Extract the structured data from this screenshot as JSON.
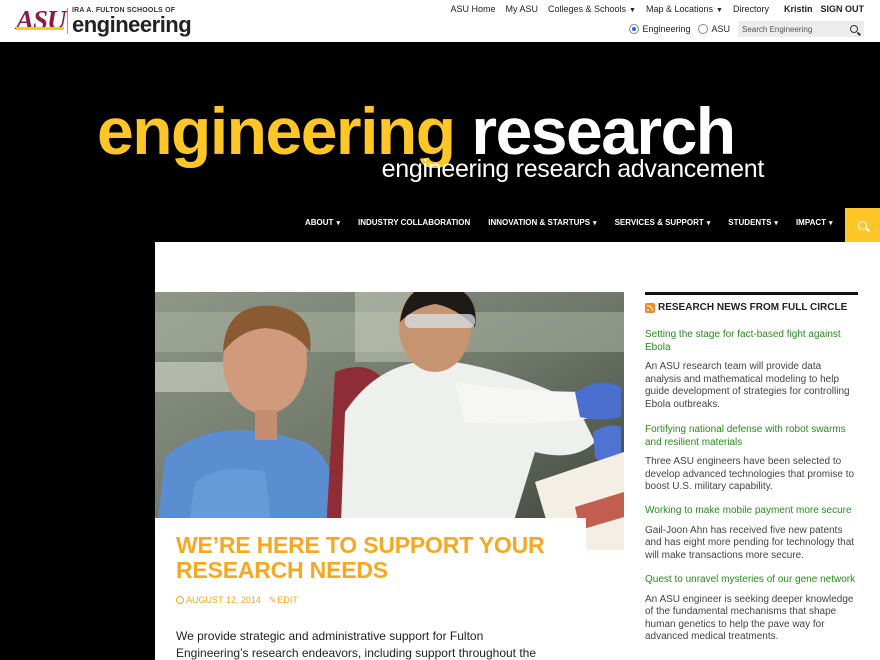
{
  "logo": {
    "mark": "ASU",
    "sub": "IRA A. FULTON SCHOOLS OF",
    "main": "engineering"
  },
  "utility_nav": {
    "items": [
      {
        "label": "ASU Home",
        "has_caret": false
      },
      {
        "label": "My ASU",
        "has_caret": false
      },
      {
        "label": "Colleges & Schools",
        "has_caret": true
      },
      {
        "label": "Map & Locations",
        "has_caret": true
      },
      {
        "label": "Directory",
        "has_caret": false
      }
    ],
    "user": "Kristin",
    "signout": "SIGN OUT"
  },
  "search": {
    "radio_engineering": "Engineering",
    "radio_asu": "ASU",
    "selected": "Engineering",
    "placeholder": "Search Engineering"
  },
  "hero": {
    "title_gold": "engineering",
    "title_white": "research",
    "subtitle": "engineering research advancement"
  },
  "main_nav": {
    "items": [
      {
        "label": "ABOUT",
        "caret": "▾"
      },
      {
        "label": "INDUSTRY COLLABORATION",
        "caret": ""
      },
      {
        "label": "INNOVATION & STARTUPS",
        "caret": "▾"
      },
      {
        "label": "SERVICES & SUPPORT",
        "caret": "▾"
      },
      {
        "label": "STUDENTS",
        "caret": "▾"
      },
      {
        "label": "IMPACT",
        "caret": "▾"
      }
    ]
  },
  "article": {
    "title": "WE’RE HERE TO SUPPORT YOUR RESEARCH NEEDS",
    "date": "AUGUST 12, 2014",
    "edit": "EDIT",
    "body": "We provide strategic and administrative support for Fulton Engineering’s research endeavors, including support throughout the proposal process,"
  },
  "sidebar": {
    "heading": "RESEARCH NEWS FROM FULL CIRCLE",
    "news": [
      {
        "title": "Setting the stage for fact-based fight against Ebola",
        "desc": "An ASU research team will provide data analysis and mathematical modeling to help guide development of strategies for controlling Ebola outbreaks."
      },
      {
        "title": "Fortifying national defense with robot swarms and resilient materials",
        "desc": "Three ASU engineers have been selected to develop advanced technologies that promise to boost U.S. military capability."
      },
      {
        "title": "Working to make mobile payment more secure",
        "desc": "Gail-Joon Ahn has received five new patents and has eight more pending for technology that will make transactions more secure."
      },
      {
        "title": "Quest to unravel mysteries of our gene network",
        "desc": "An ASU engineer is seeking deeper knowledge of the fundamental mechanisms that shape human genetics to help the pave way for advanced medical treatments."
      }
    ]
  },
  "colors": {
    "asu_maroon": "#8c1d40",
    "asu_gold": "#ffc627",
    "title_orange": "#f7a823",
    "link_green": "#2a8a1f"
  }
}
